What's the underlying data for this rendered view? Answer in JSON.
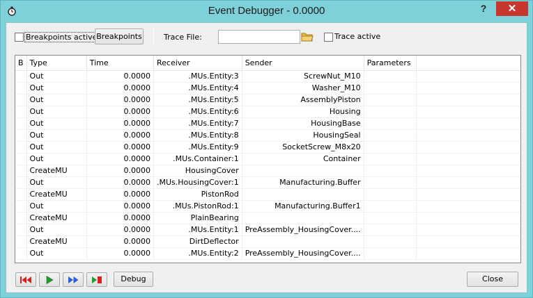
{
  "window": {
    "title": "Event Debugger - 0.0000",
    "help": "?",
    "close": "✕"
  },
  "toolbar": {
    "breakpoints_active": "Breakpoints active",
    "breakpoints_button": "Breakpoints",
    "trace_file_label": "Trace File:",
    "trace_file_value": "",
    "trace_active": "Trace active"
  },
  "table": {
    "columns": [
      "B",
      "Type",
      "Time",
      "Receiver",
      "Sender",
      "Parameters"
    ],
    "rows": [
      {
        "b": "",
        "type": "Out",
        "time": "0.0000",
        "receiver": ".MUs.Entity:3",
        "sender": "ScrewNut_M10",
        "params": ""
      },
      {
        "b": "",
        "type": "Out",
        "time": "0.0000",
        "receiver": ".MUs.Entity:4",
        "sender": "Washer_M10",
        "params": ""
      },
      {
        "b": "",
        "type": "Out",
        "time": "0.0000",
        "receiver": ".MUs.Entity:5",
        "sender": "AssemblyPiston",
        "params": ""
      },
      {
        "b": "",
        "type": "Out",
        "time": "0.0000",
        "receiver": ".MUs.Entity:6",
        "sender": "Housing",
        "params": ""
      },
      {
        "b": "",
        "type": "Out",
        "time": "0.0000",
        "receiver": ".MUs.Entity:7",
        "sender": "HousingBase",
        "params": ""
      },
      {
        "b": "",
        "type": "Out",
        "time": "0.0000",
        "receiver": ".MUs.Entity:8",
        "sender": "HousingSeal",
        "params": ""
      },
      {
        "b": "",
        "type": "Out",
        "time": "0.0000",
        "receiver": ".MUs.Entity:9",
        "sender": "SocketScrew_M8x20",
        "params": ""
      },
      {
        "b": "",
        "type": "Out",
        "time": "0.0000",
        "receiver": ".MUs.Container:1",
        "sender": "Container",
        "params": ""
      },
      {
        "b": "",
        "type": "CreateMU",
        "time": "0.0000",
        "receiver": "HousingCover",
        "sender": "",
        "params": ""
      },
      {
        "b": "",
        "type": "Out",
        "time": "0.0000",
        "receiver": ".MUs.HousingCover:1",
        "sender": "Manufacturing.Buffer",
        "params": ""
      },
      {
        "b": "",
        "type": "CreateMU",
        "time": "0.0000",
        "receiver": "PistonRod",
        "sender": "",
        "params": ""
      },
      {
        "b": "",
        "type": "Out",
        "time": "0.0000",
        "receiver": ".MUs.PistonRod:1",
        "sender": "Manufacturing.Buffer1",
        "params": ""
      },
      {
        "b": "",
        "type": "CreateMU",
        "time": "0.0000",
        "receiver": "PlainBearing",
        "sender": "",
        "params": ""
      },
      {
        "b": "",
        "type": "Out",
        "time": "0.0000",
        "receiver": ".MUs.Entity:1",
        "sender": "PreAssembly_HousingCover....",
        "params": ""
      },
      {
        "b": "",
        "type": "CreateMU",
        "time": "0.0000",
        "receiver": "DirtDeflector",
        "sender": "",
        "params": ""
      },
      {
        "b": "",
        "type": "Out",
        "time": "0.0000",
        "receiver": ".MUs.Entity:2",
        "sender": "PreAssembly_HousingCover....",
        "params": ""
      }
    ]
  },
  "footer": {
    "debug_button": "Debug",
    "close_button": "Close"
  },
  "icons": {
    "app": "stopwatch-icon",
    "folder": "folder-icon",
    "rewind": "rewind-icon",
    "play": "play-icon",
    "fast_forward": "fast-forward-icon",
    "step_stop": "step-stop-icon"
  },
  "colors": {
    "frame": "#7ed1d9",
    "close": "#c7372f",
    "rewind": "#d82020",
    "play": "#1e9e2a",
    "fast_forward": "#2e5fd8"
  }
}
